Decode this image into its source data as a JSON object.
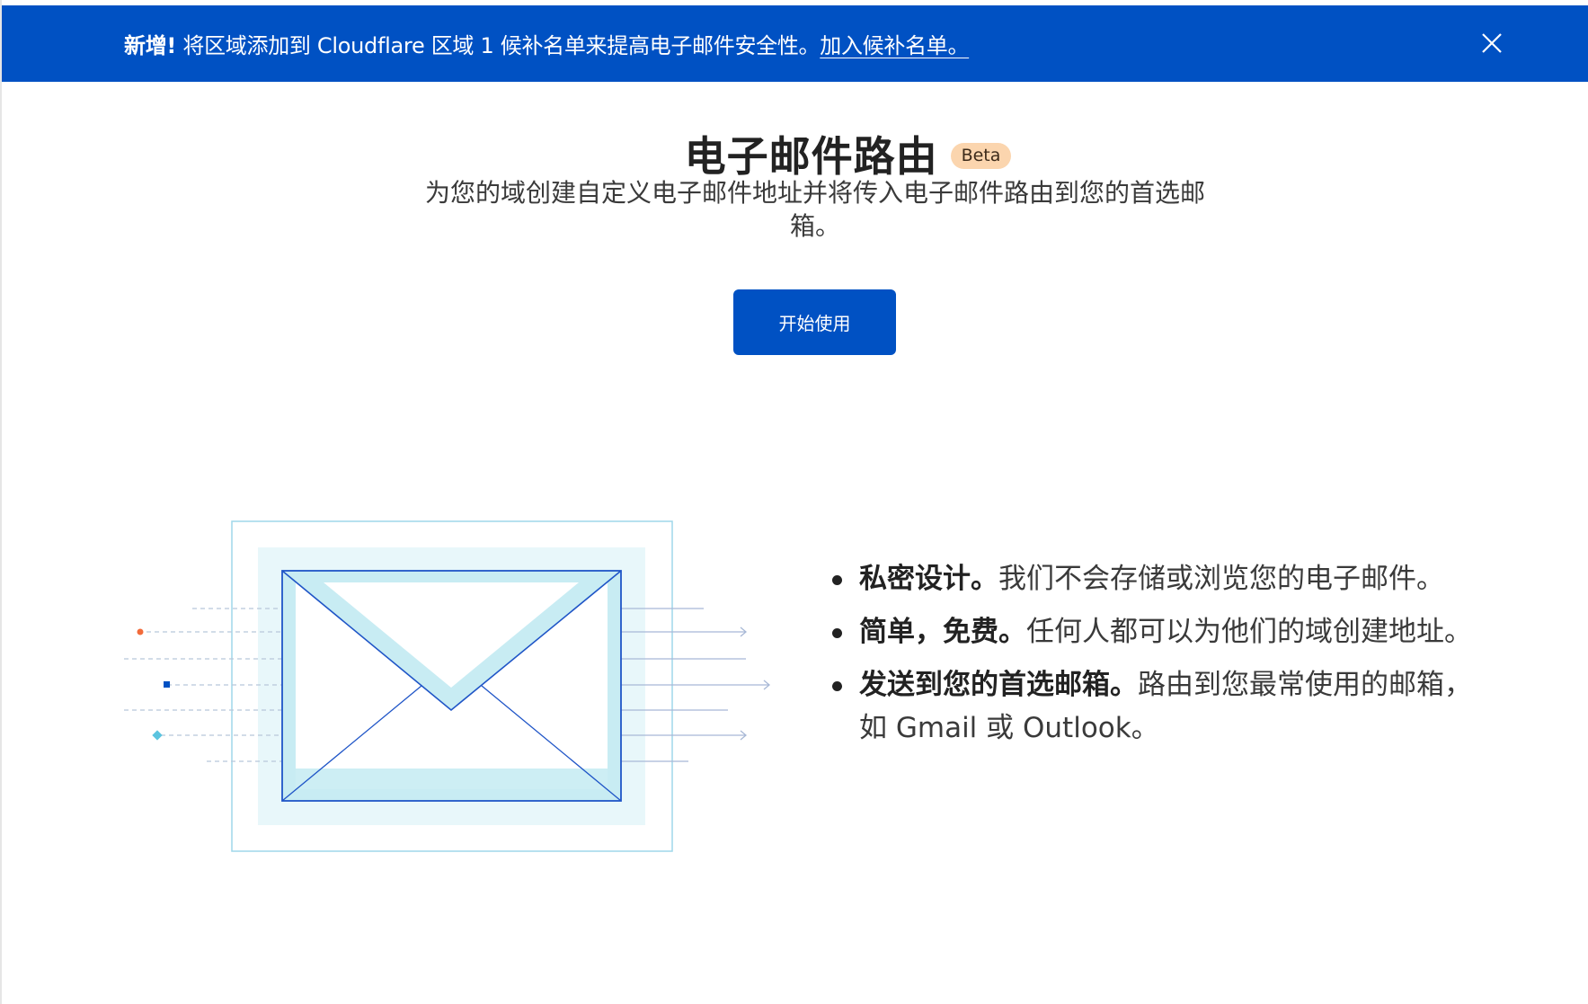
{
  "banner": {
    "strong": "新增!",
    "text": "将区域添加到 Cloudflare 区域 1 候补名单来提高电子邮件安全性。",
    "link": "加入候补名单。"
  },
  "header": {
    "title": "电子邮件路由",
    "badge": "Beta",
    "subtitle": "为您的域创建自定义电子邮件地址并将传入电子邮件路由到您的首选邮箱。"
  },
  "cta": {
    "label": "开始使用"
  },
  "features": [
    {
      "strong": "私密设计。",
      "text": "我们不会存储或浏览您的电子邮件。"
    },
    {
      "strong": "简单，免费。",
      "text": "任何人都可以为他们的域创建地址。"
    },
    {
      "strong": "发送到您的首选邮箱。",
      "text": "路由到您最常使用的邮箱，如 Gmail 或 Outlook。"
    }
  ],
  "icons": {
    "close": "close-icon",
    "illustration": "envelope-icon"
  },
  "colors": {
    "brand_blue": "#0051c3",
    "badge_bg": "#fbd5ae",
    "envelope_light": "#c8ecf3",
    "envelope_frame": "#e8f7fa",
    "dot_orange": "#f26b3a",
    "dot_teal": "#5bc4df"
  }
}
